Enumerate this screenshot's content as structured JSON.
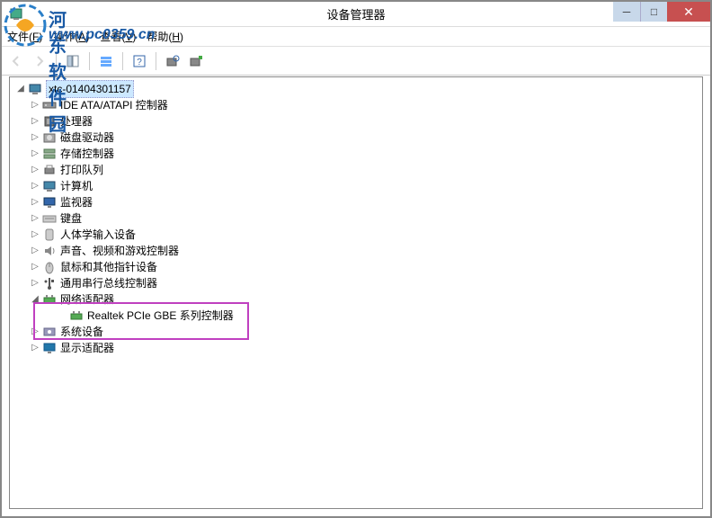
{
  "window": {
    "title": "设备管理器",
    "min_tip": "最小化",
    "max_tip": "最大化",
    "close_tip": "关闭"
  },
  "menu": {
    "file": "文件(F)",
    "action": "操作(A)",
    "view": "查看(V)",
    "help": "帮助(H)"
  },
  "watermark": {
    "site_name": "河东软件园",
    "site_url": "www.pc0359.cn"
  },
  "tree": {
    "root": "xtc-01404301157",
    "nodes": [
      {
        "label": "IDE ATA/ATAPI 控制器",
        "icon": "ide"
      },
      {
        "label": "处理器",
        "icon": "cpu"
      },
      {
        "label": "磁盘驱动器",
        "icon": "disk"
      },
      {
        "label": "存储控制器",
        "icon": "storage"
      },
      {
        "label": "打印队列",
        "icon": "printer"
      },
      {
        "label": "计算机",
        "icon": "computer"
      },
      {
        "label": "监视器",
        "icon": "monitor"
      },
      {
        "label": "键盘",
        "icon": "keyboard"
      },
      {
        "label": "人体学输入设备",
        "icon": "hid"
      },
      {
        "label": "声音、视频和游戏控制器",
        "icon": "audio"
      },
      {
        "label": "鼠标和其他指针设备",
        "icon": "mouse"
      },
      {
        "label": "通用串行总线控制器",
        "icon": "usb"
      },
      {
        "label": "网络适配器",
        "icon": "network",
        "expanded": true,
        "children": [
          {
            "label": "Realtek PCIe GBE 系列控制器",
            "icon": "network"
          }
        ]
      },
      {
        "label": "系统设备",
        "icon": "system"
      },
      {
        "label": "显示适配器",
        "icon": "display"
      }
    ]
  }
}
